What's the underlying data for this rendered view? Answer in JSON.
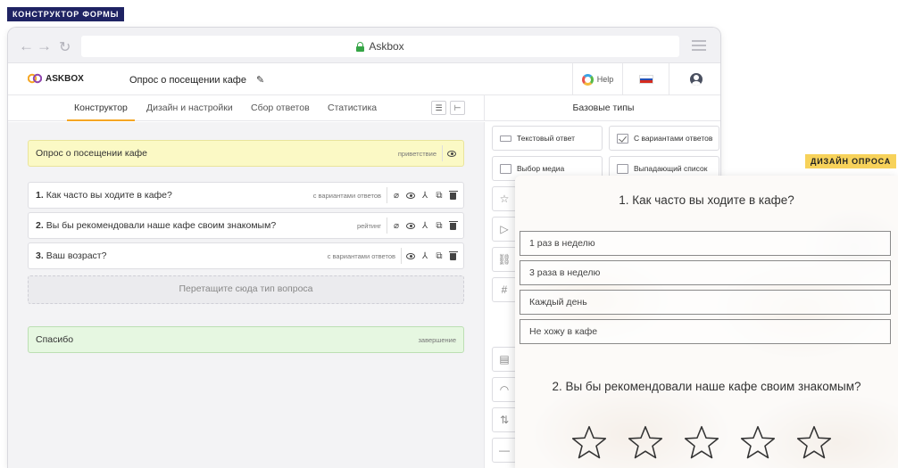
{
  "badges": {
    "constructor": "КОНСТРУКТОР ФОРМЫ",
    "design": "ДИЗАЙН ОПРОСА"
  },
  "browser": {
    "url": "Askbox"
  },
  "app": {
    "logo": "ASKBOX",
    "form_title": "Опрос о посещении кафе",
    "help": "Help"
  },
  "tabs": [
    {
      "label": "Конструктор",
      "active": true
    },
    {
      "label": "Дизайн и настройки",
      "active": false
    },
    {
      "label": "Сбор ответов",
      "active": false
    },
    {
      "label": "Статистика",
      "active": false
    }
  ],
  "sidebar": {
    "title": "Базовые типы",
    "types": [
      {
        "label": "Текстовый ответ",
        "icon": "text-field-icon"
      },
      {
        "label": "С вариантами ответов",
        "icon": "checkbox-icon"
      },
      {
        "label": "Выбор медиа",
        "icon": "media-icon"
      },
      {
        "label": "Выпадающий список",
        "icon": "dropdown-icon"
      }
    ]
  },
  "canvas": {
    "welcome": {
      "text": "Опрос о посещении кафе",
      "type": "приветствие"
    },
    "questions": [
      {
        "num": "1.",
        "text": "Как часто вы ходите в кафе?",
        "type": "с вариантами ответов"
      },
      {
        "num": "2.",
        "text": "Вы бы рекомендовали наше кафе своим знакомым?",
        "type": "рейтинг"
      },
      {
        "num": "3.",
        "text": "Ваш возраст?",
        "type": "с вариантами ответов"
      }
    ],
    "drop_zone": "Перетащите сюда тип вопроса",
    "thanks": {
      "text": "Спасибо",
      "type": "завершение"
    }
  },
  "preview": {
    "q1": "1. Как часто вы ходите в кафе?",
    "options": [
      "1 раз в неделю",
      "3 раза в неделю",
      "Каждый день",
      "Не хожу в кафе"
    ],
    "q2": "2. Вы бы рекомендовали наше кафе своим знакомым?",
    "stars": 5
  },
  "colors": {
    "badge_dark": "#1f2363",
    "badge_yellow": "#f7d25a",
    "tab_accent": "#f5a623",
    "welcome_bg": "#fbf9c5",
    "thanks_bg": "#e6f7e1"
  }
}
